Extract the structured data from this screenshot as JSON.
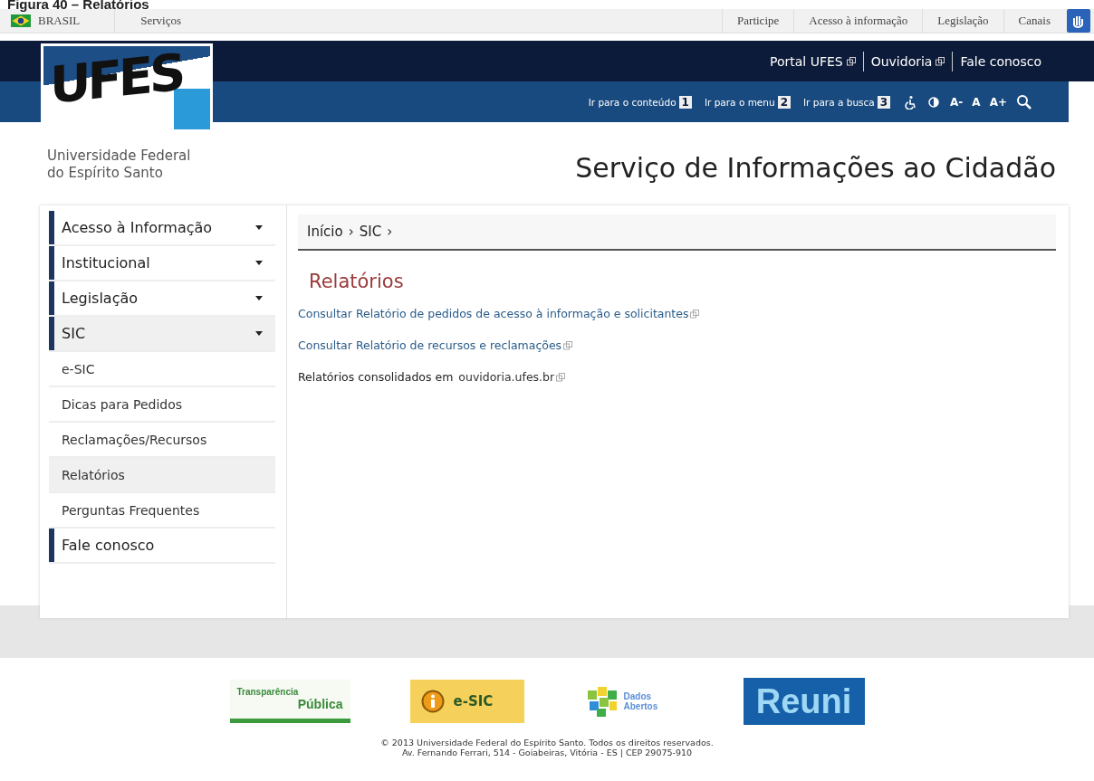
{
  "caption": "Figura 40 – Relatórios",
  "gov_bar": {
    "country": "BRASIL",
    "left_links": [
      "Serviços"
    ],
    "right_links": [
      "Participe",
      "Acesso à informação",
      "Legislação",
      "Canais"
    ]
  },
  "top_links": [
    "Portal UFES",
    "Ouvidoria",
    "Fale conosco"
  ],
  "access_bar": {
    "skip_links": [
      {
        "label": "Ir para o conteúdo",
        "key": "1"
      },
      {
        "label": "Ir para o menu",
        "key": "2"
      },
      {
        "label": "Ir para a busca",
        "key": "3"
      }
    ],
    "font_sizes": [
      "A-",
      "A",
      "A+"
    ]
  },
  "logo": {
    "mark": "UFES",
    "name_lines": [
      "Universidade Federal",
      "do Espírito Santo"
    ]
  },
  "site_title": "Serviço de Informações ao Cidadão",
  "sidebar": {
    "items": [
      {
        "label": "Acesso à Informação",
        "kind": "menu",
        "expanded": false
      },
      {
        "label": "Institucional",
        "kind": "menu",
        "expanded": false
      },
      {
        "label": "Legislação",
        "kind": "menu",
        "expanded": false
      },
      {
        "label": "SIC",
        "kind": "menu",
        "expanded": true,
        "children": [
          {
            "label": "e-SIC",
            "selected": false
          },
          {
            "label": "Dicas para Pedidos",
            "selected": false
          },
          {
            "label": "Reclamações/Recursos",
            "selected": false
          },
          {
            "label": "Relatórios",
            "selected": true
          },
          {
            "label": "Perguntas Frequentes",
            "selected": false
          }
        ]
      },
      {
        "label": "Fale conosco",
        "kind": "link"
      }
    ]
  },
  "breadcrumb": {
    "items": [
      "Início",
      "SIC"
    ],
    "separator": "›"
  },
  "heading": "Relatórios",
  "content": [
    {
      "kind": "link",
      "text": "Consultar Relatório de pedidos de acesso à informação e solicitantes"
    },
    {
      "kind": "link",
      "text": "Consultar Relatório de recursos e reclamações"
    },
    {
      "kind": "text_link",
      "text": "Relatórios consolidados em",
      "link": "ouvidoria.ufes.br"
    }
  ],
  "footer": {
    "badges": [
      {
        "kind": "transparencia",
        "lines": [
          "Transparência",
          "Pública"
        ]
      },
      {
        "kind": "esic",
        "lines": [
          "e-SIC"
        ]
      },
      {
        "kind": "dados",
        "lines": [
          "Dados",
          "Abertos"
        ]
      },
      {
        "kind": "reuni",
        "lines": [
          "Reuni"
        ]
      }
    ],
    "copyright": [
      "© 2013 Universidade Federal do Espírito Santo. Todos os direitos reservados.",
      "Av. Fernando Ferrari, 514 - Goiabeiras, Vitória - ES | CEP 29075-910"
    ]
  }
}
